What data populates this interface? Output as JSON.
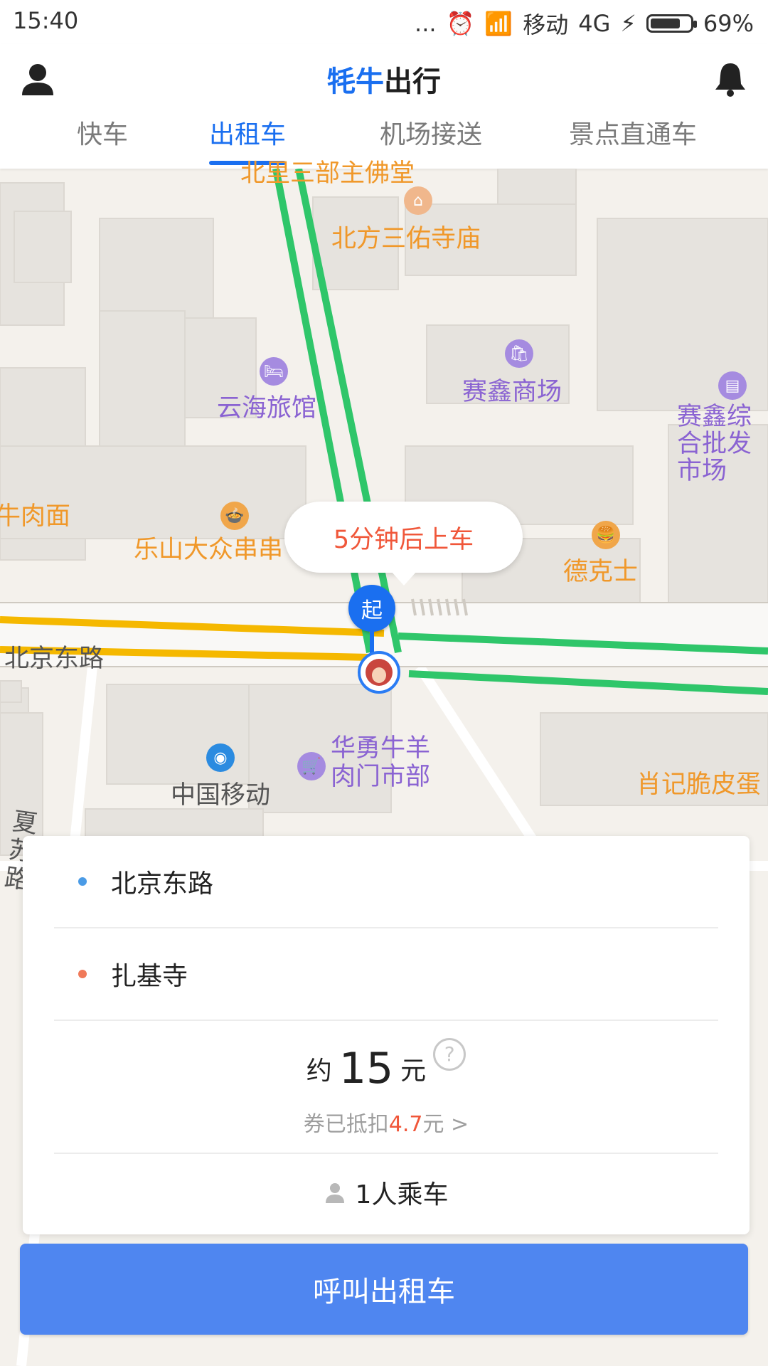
{
  "status_bar": {
    "time": "15:40",
    "dots": "...",
    "carrier": "移动",
    "network": "4G",
    "battery": "69%"
  },
  "header": {
    "brand_part1": "牦牛",
    "brand_part2": "出行"
  },
  "tabs": [
    {
      "label": "快车",
      "active": false
    },
    {
      "label": "出租车",
      "active": true
    },
    {
      "label": "机场接送",
      "active": false
    },
    {
      "label": "景点直通车",
      "active": false
    }
  ],
  "map": {
    "pois": [
      {
        "name": "北方三佑寺庙",
        "type": "temple"
      },
      {
        "name": "赛鑫商场",
        "type": "shopping"
      },
      {
        "name": "云海旅馆",
        "type": "hotel"
      },
      {
        "name": "赛鑫综合批发市场",
        "type": "market"
      },
      {
        "name": "牛肉面",
        "type": "food"
      },
      {
        "name": "乐山大众串串",
        "type": "food"
      },
      {
        "name": "德克士",
        "type": "food"
      },
      {
        "name": "中国移动",
        "type": "telecom"
      },
      {
        "name": "华勇牛羊肉门市部",
        "type": "shop"
      },
      {
        "name": "肖记脆皮蛋",
        "type": "food"
      },
      {
        "name": "北京东路",
        "type": "road"
      },
      {
        "name": "夏苏路",
        "type": "road"
      },
      {
        "name": "北里三部主佛堂",
        "type": "temple"
      }
    ],
    "bubble_text": "5分钟后上车",
    "start_pin_label": "起"
  },
  "trip": {
    "origin": "北京东路",
    "destination": "扎基寺",
    "origin_color": "#4a9be6",
    "destination_color": "#f07a5a",
    "price_prefix": "约",
    "price_value": "15",
    "price_unit": "元",
    "help_symbol": "?",
    "coupon_prefix": "券已抵扣",
    "coupon_amount": "4.7",
    "coupon_suffix": "元 >",
    "passengers": "1人乘车"
  },
  "call_button": {
    "label": "呼叫出租车",
    "color": "#4f86f0"
  },
  "accent_color": "#1a6ff0"
}
